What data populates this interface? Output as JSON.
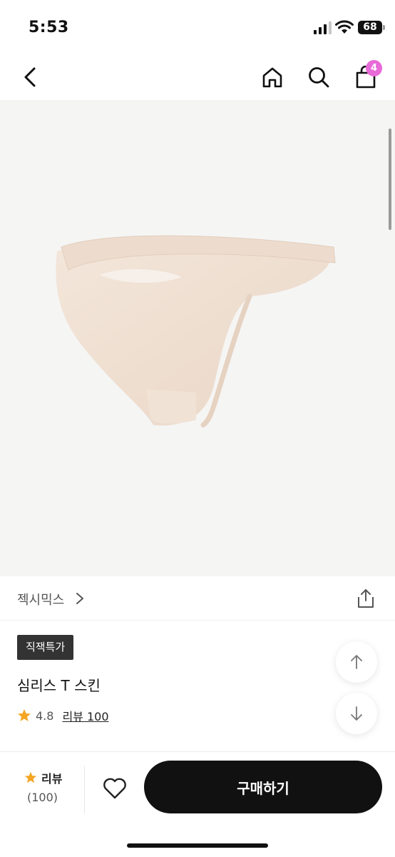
{
  "status_bar": {
    "time": "5:53",
    "battery": "68"
  },
  "nav": {
    "back_icon": "chevron-left-icon",
    "home_icon": "home-icon",
    "search_icon": "search-icon",
    "cart_icon": "shopping-bag-icon",
    "cart_count": "4",
    "badge_color": "#e86ad8"
  },
  "brand": {
    "name": "젝시믹스"
  },
  "product": {
    "tag": "직잭특가",
    "title": "심리스 T 스킨",
    "rating": "4.8",
    "review_link": "리뷰 100"
  },
  "bottom_bar": {
    "review_label": "리뷰",
    "review_count": "(100)",
    "buy_label": "구매하기"
  },
  "colors": {
    "star": "#f5a623",
    "buy_button": "#111111"
  }
}
